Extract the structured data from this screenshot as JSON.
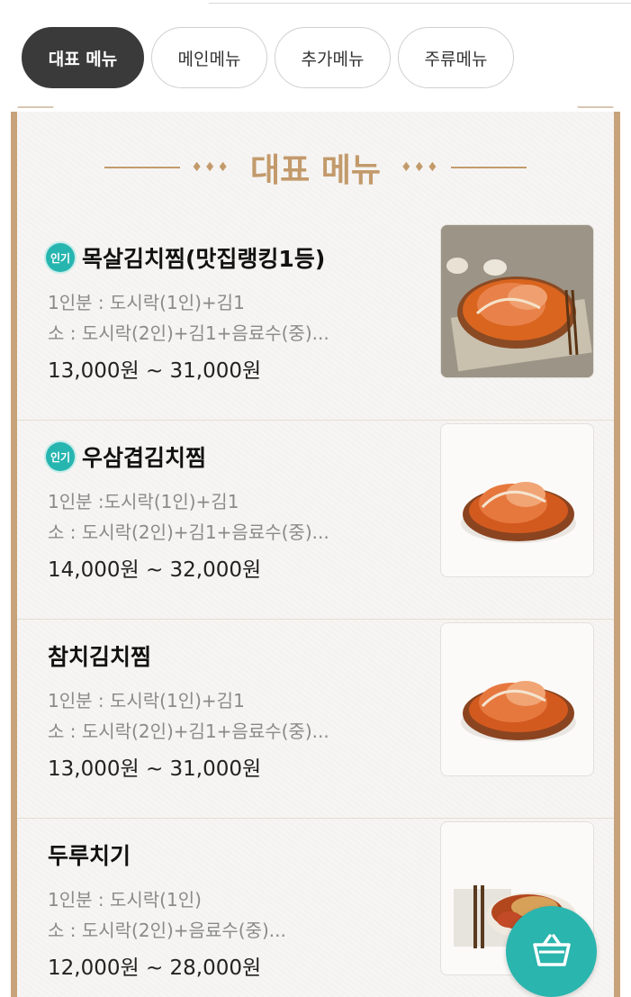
{
  "tabs": [
    {
      "label": "대표 메뉴",
      "active": true
    },
    {
      "label": "메인메뉴",
      "active": false
    },
    {
      "label": "추가메뉴",
      "active": false
    },
    {
      "label": "주류메뉴",
      "active": false
    }
  ],
  "section": {
    "title": "대표 메뉴",
    "ornament_left": "♦♦♦",
    "ornament_right": "♦♦♦"
  },
  "items": [
    {
      "badge": "인기",
      "name": "목살김치찜(맛집랭킹1등)",
      "desc1": "1인분 : 도시락(1인)+김1",
      "desc2": "소 : 도시락(2인)+김1+음료수(중)...",
      "price": "13,000원 ~ 31,000원",
      "photo_icon": "kimchi-jjim-dish-photo"
    },
    {
      "badge": "인기",
      "name": "우삼겹김치찜",
      "desc1": "1인분 :도시락(1인)+김1",
      "desc2": "소 : 도시락(2인)+김1+음료수(중)...",
      "price": "14,000원 ~ 32,000원",
      "photo_icon": "kimchi-jjim-dish-photo"
    },
    {
      "badge": "",
      "name": "참치김치찜",
      "desc1": "1인분 : 도시락(1인)+김1",
      "desc2": "소 : 도시락(2인)+김1+음료수(중)...",
      "price": "13,000원 ~ 31,000원",
      "photo_icon": "kimchi-jjim-dish-photo"
    },
    {
      "badge": "",
      "name": "두루치기",
      "desc1": "1인분 : 도시락(1인)",
      "desc2": "소 : 도시락(2인)+음료수(중)...",
      "price": "12,000원 ~ 28,000원",
      "photo_icon": "duruchigi-dish-photo"
    }
  ],
  "cart": {
    "icon": "basket-icon"
  },
  "colors": {
    "accent": "#2ab5ae",
    "gold": "#c39a6b",
    "active_tab": "#3a3a3a"
  }
}
